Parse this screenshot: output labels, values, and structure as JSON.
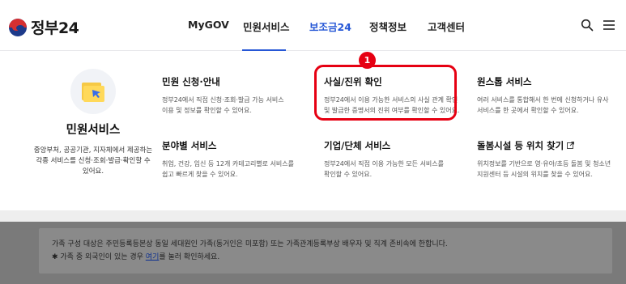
{
  "header": {
    "logo_text": "정부24",
    "nav": [
      {
        "label": "MyGOV"
      },
      {
        "label": "민원서비스",
        "active": true
      },
      {
        "label": "보조금24"
      },
      {
        "label": "정책정보"
      },
      {
        "label": "고객센터"
      }
    ],
    "icons": [
      "search-icon",
      "menu-icon"
    ]
  },
  "menu": {
    "intro": {
      "title": "민원서비스",
      "desc_line1": "중앙부처, 공공기관, 지자체에서 제공하는",
      "desc_line2": "각종 서비스를 신청·조회·발급·확인할 수 있어요."
    },
    "cards": [
      {
        "title": "민원 신청·안내",
        "desc_line1": "정부24에서 직접 신청·조회·발급 가능 서비스",
        "desc_line2": "이용 및 정보를 확인할 수 있어요."
      },
      {
        "title": "사실/진위 확인",
        "desc_line1": "정부24에서 이용 가능한 서비스의 사실 관계 확인",
        "desc_line2": "및 발급한 증명서의 진위 여부를 확인할 수 있어요."
      },
      {
        "title": "원스톱 서비스",
        "desc_line1": "여러 서비스를 통합해서 한 번에 신청하거나 유사",
        "desc_line2": "서비스를 한 곳에서 확인할 수 있어요."
      },
      {
        "title": "분야별 서비스",
        "desc_line1": "취업, 건강, 임신 등 12개 카테고리별로 서비스를",
        "desc_line2": "쉽고 빠르게 찾을 수 있어요."
      },
      {
        "title": "기업/단체 서비스",
        "desc_line1": "정부24에서 직접 이용 가능한 모든 서비스를",
        "desc_line2": "확인할 수 있어요."
      },
      {
        "title": "돌봄시설 등 위치 찾기",
        "desc_line1": "위치정보를 기반으로 영·유아/초등 돌봄 및 청소년",
        "desc_line2": "지원센터 등 시설의 위치를 찾을 수 있어요."
      }
    ],
    "step_badge": "1"
  },
  "notice": {
    "line1": "가족 구성 대상은 주민등록등본상 동일 세대원인 가족(동거인은 미포함) 또는 가족관계등록부상 배우자 및 직계 존비속에 한합니다.",
    "line2_prefix": "✱ 가족 중 외국인이 있는 경우 ",
    "line2_link": "여기",
    "line2_suffix": "를 눌러 확인하세요."
  },
  "colors": {
    "accent": "#2657d6",
    "highlight": "#e60012"
  }
}
